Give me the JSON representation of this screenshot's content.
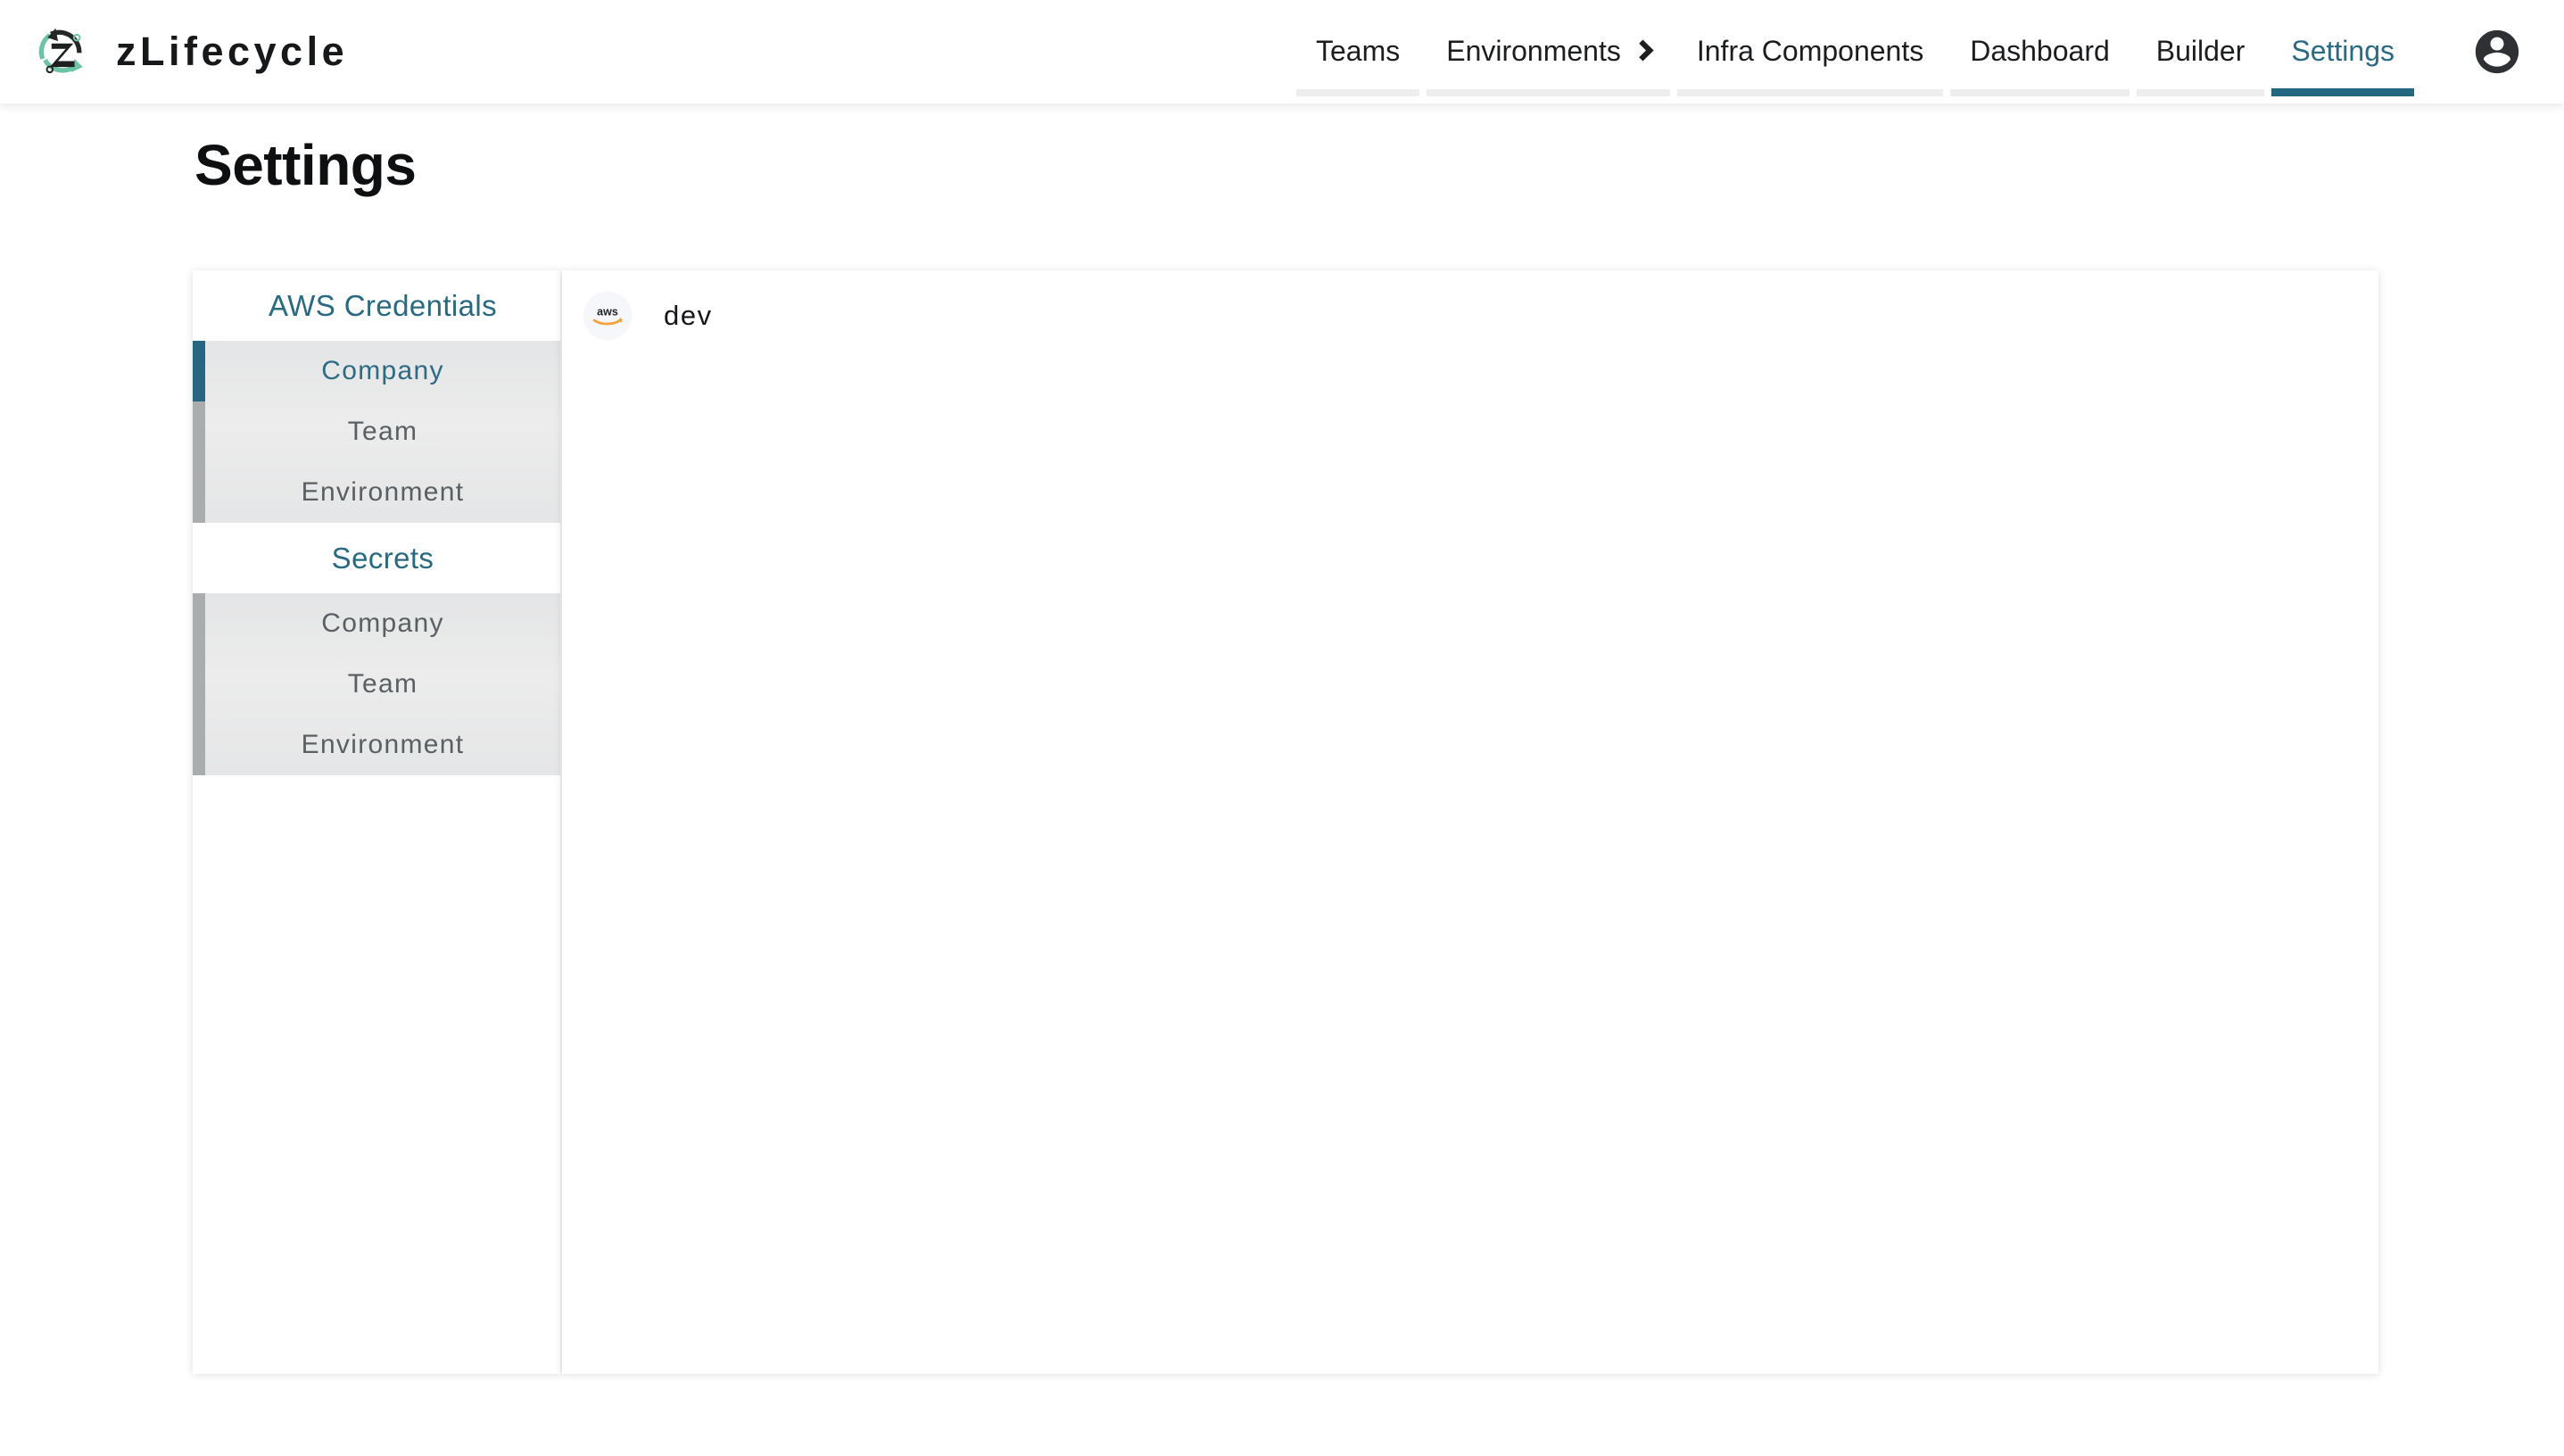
{
  "brand": {
    "name": "zLifecycle",
    "logo_icon": "zlifecycle-recycle-logo"
  },
  "nav": {
    "items": [
      {
        "label": "Teams",
        "active": false,
        "has_chevron": false
      },
      {
        "label": "Environments",
        "active": false,
        "has_chevron": true
      },
      {
        "label": "Infra Components",
        "active": false,
        "has_chevron": false
      },
      {
        "label": "Dashboard",
        "active": false,
        "has_chevron": false
      },
      {
        "label": "Builder",
        "active": false,
        "has_chevron": false
      },
      {
        "label": "Settings",
        "active": true,
        "has_chevron": false
      }
    ],
    "account_icon": "account-circle-icon"
  },
  "page": {
    "title": "Settings"
  },
  "sidebar": {
    "groups": [
      {
        "header": "AWS Credentials",
        "items": [
          {
            "label": "Company",
            "selected": true
          },
          {
            "label": "Team",
            "selected": false
          },
          {
            "label": "Environment",
            "selected": false
          }
        ]
      },
      {
        "header": "Secrets",
        "items": [
          {
            "label": "Company",
            "selected": false
          },
          {
            "label": "Team",
            "selected": false
          },
          {
            "label": "Environment",
            "selected": false
          }
        ]
      }
    ]
  },
  "content": {
    "credentials": [
      {
        "provider_icon": "aws-logo-icon",
        "name": "dev"
      }
    ]
  },
  "colors": {
    "accent_teal": "#256781",
    "brand_green": "#6cc3a6",
    "aws_orange": "#f5a13c",
    "text_dark": "#16181a",
    "text_muted": "#5a5f63",
    "tab_underline_inactive": "#eeeeee",
    "sidebar_item_bg": "#ececec",
    "sidebar_bar_inactive": "#a9adad"
  }
}
